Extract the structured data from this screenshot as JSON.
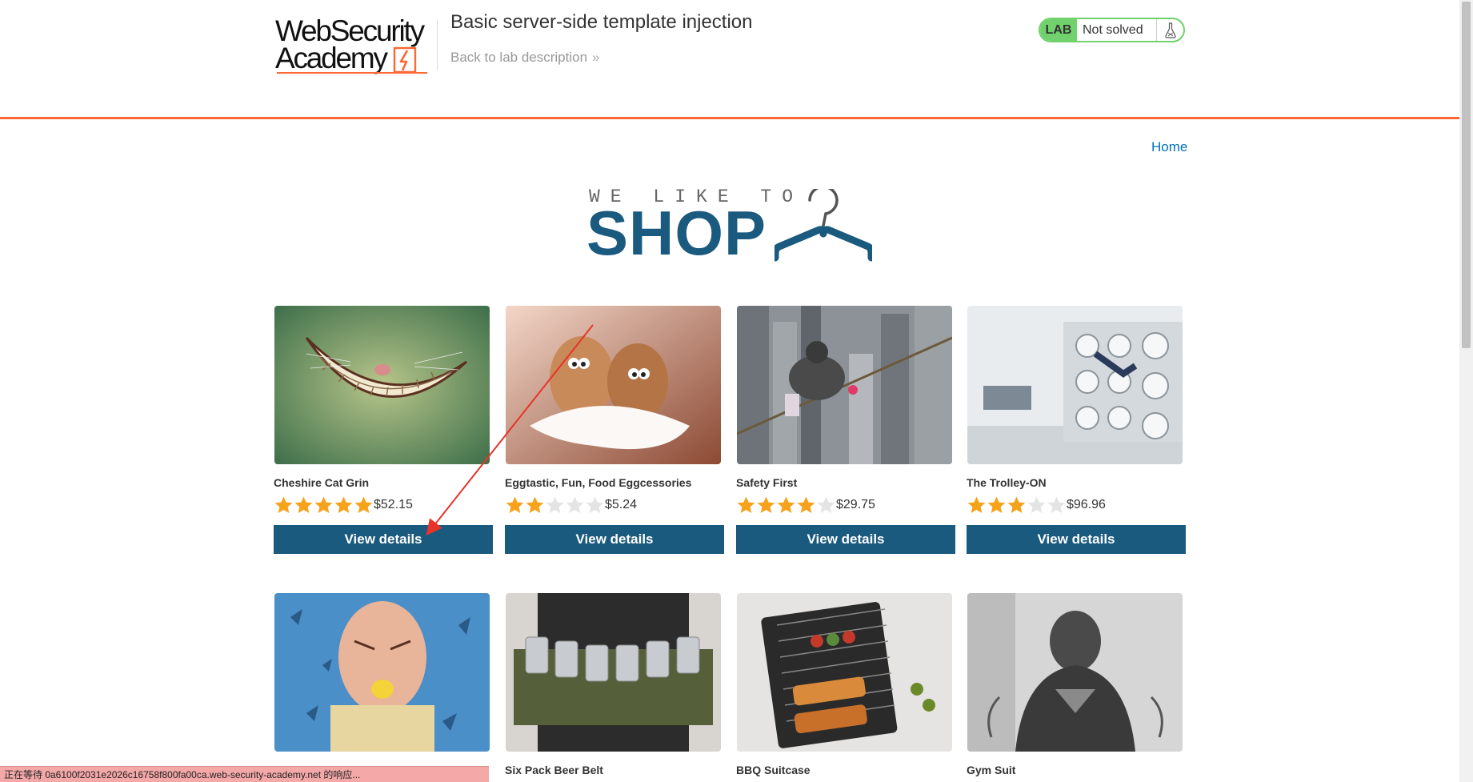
{
  "header": {
    "logo_line1": "WebSecurity",
    "logo_line2": "Academy",
    "lab_title": "Basic server-side template injection",
    "back_link": "Back to lab description",
    "lab_badge": "LAB",
    "lab_status": "Not solved",
    "accent_color": "#ff6633",
    "status_color": "#70d16d"
  },
  "nav": {
    "home": "Home"
  },
  "banner": {
    "top": "WE LIKE TO",
    "main": "SHOP",
    "icon": "hanger-icon"
  },
  "products": [
    {
      "name": "Cheshire Cat Grin",
      "rating": 5,
      "price": "$52.15",
      "button": "View details"
    },
    {
      "name": "Eggtastic, Fun, Food Eggcessories",
      "rating": 2,
      "price": "$5.24",
      "button": "View details"
    },
    {
      "name": "Safety First",
      "rating": 4,
      "price": "$29.75",
      "button": "View details"
    },
    {
      "name": "The Trolley-ON",
      "rating": 3,
      "price": "$96.96",
      "button": "View details"
    },
    {
      "name": "",
      "rating": 0,
      "price": "",
      "button": ""
    },
    {
      "name": "Six Pack Beer Belt",
      "rating": 0,
      "price": "",
      "button": ""
    },
    {
      "name": "BBQ Suitcase",
      "rating": 0,
      "price": "",
      "button": ""
    },
    {
      "name": "Gym Suit",
      "rating": 0,
      "price": "",
      "button": ""
    }
  ],
  "status_bar": "正在等待 0a6100f2031e2026c16758f800fa00ca.web-security-academy.net 的响应...",
  "colors": {
    "button": "#1a5a7f",
    "link": "#0071bc",
    "star_on": "#f7a21b",
    "star_off": "#e4e4e4",
    "annotation_arrow": "#e8332a"
  }
}
